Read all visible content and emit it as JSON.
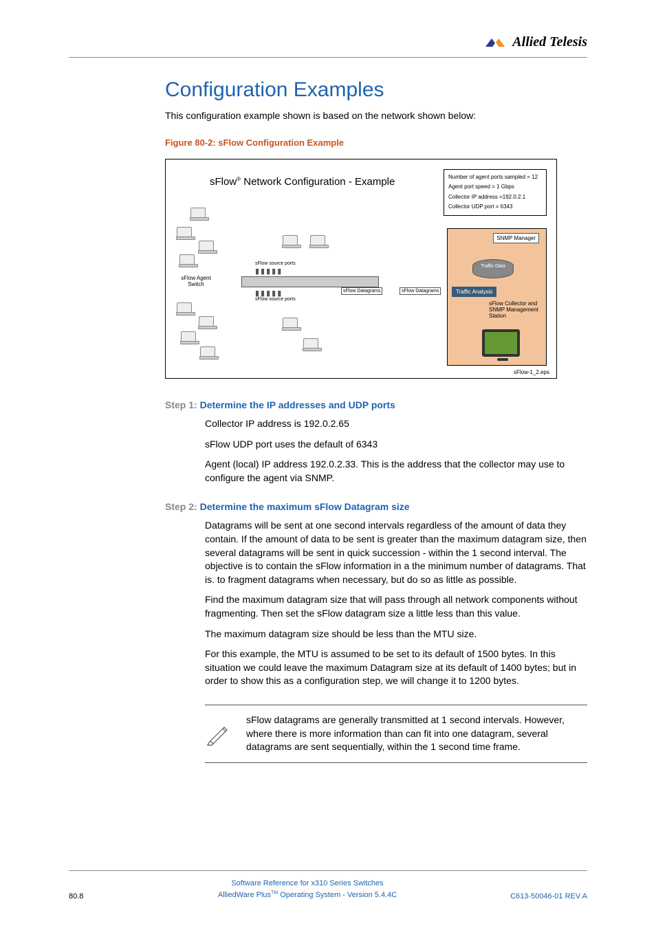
{
  "logo_text": "Allied Telesis",
  "heading": "Configuration Examples",
  "intro": "This configuration example shown is based on the network shown below:",
  "figure_caption": "Figure 80-2: sFlow Configuration Example",
  "figure": {
    "title_pre": "sFlow",
    "title_post": " Network Configuration - Example",
    "reg": "®",
    "info_lines": {
      "l1": "Number of agent ports sampled = 12",
      "l2": "Agent port speed = 1 Gbps",
      "l3": "Collector IP address =192.0.2.1",
      "l4": "Collector UDP port = 6343"
    },
    "snmp_manager": "SNMP Manager",
    "traffic_data": "Traffic Data",
    "traffic_analysis": "Traffic Analysis",
    "collector_label": "sFlow Collector and SNMP Management Station",
    "switch_label": "sFlow Agent Switch",
    "src_ports": "sFlow source ports",
    "datagram": "sFlow Datagrams",
    "eps": "sFlow-1_2.eps"
  },
  "step1": {
    "label": "Step 1: ",
    "title": "Determine the IP addresses and UDP ports",
    "p1": "Collector IP address is 192.0.2.65",
    "p2": "sFlow UDP port uses the default of 6343",
    "p3": "Agent (local) IP address 192.0.2.33. This is the address that the collector may use to configure the agent via SNMP."
  },
  "step2": {
    "label": "Step 2: ",
    "title": "Determine the maximum sFlow Datagram size",
    "p1": "Datagrams will be sent at one second intervals regardless of the amount of data they contain. If the amount of data to be sent is greater than the maximum datagram size, then several datagrams will be sent in quick succession - within the 1 second interval. The objective is to contain the sFlow information in a the minimum number of datagrams. That is. to fragment datagrams when necessary, but do so as little as possible.",
    "p2": "Find the maximum datagram size that will pass through all network components without fragmenting. Then set the sFlow datagram size a little less than this value.",
    "p3": "The maximum datagram size should be less than the MTU size.",
    "p4": "For this example, the MTU is assumed to be set to its default of 1500 bytes. In this situation we could leave the maximum Datagram size at its default of 1400 bytes; but in order to show this as a configuration step, we will change it to 1200 bytes."
  },
  "note": "sFlow datagrams are generally transmitted at 1 second intervals. However, where there is more information than can fit into one datagram, several datagrams are sent sequentially, within the 1 second time frame.",
  "footer": {
    "page": "80.8",
    "line1": "Software Reference for x310 Series Switches",
    "line2_pre": "AlliedWare Plus",
    "line2_tm": "TM",
    "line2_post": " Operating System  - Version 5.4.4C",
    "rev": "C613-50046-01 REV A"
  }
}
